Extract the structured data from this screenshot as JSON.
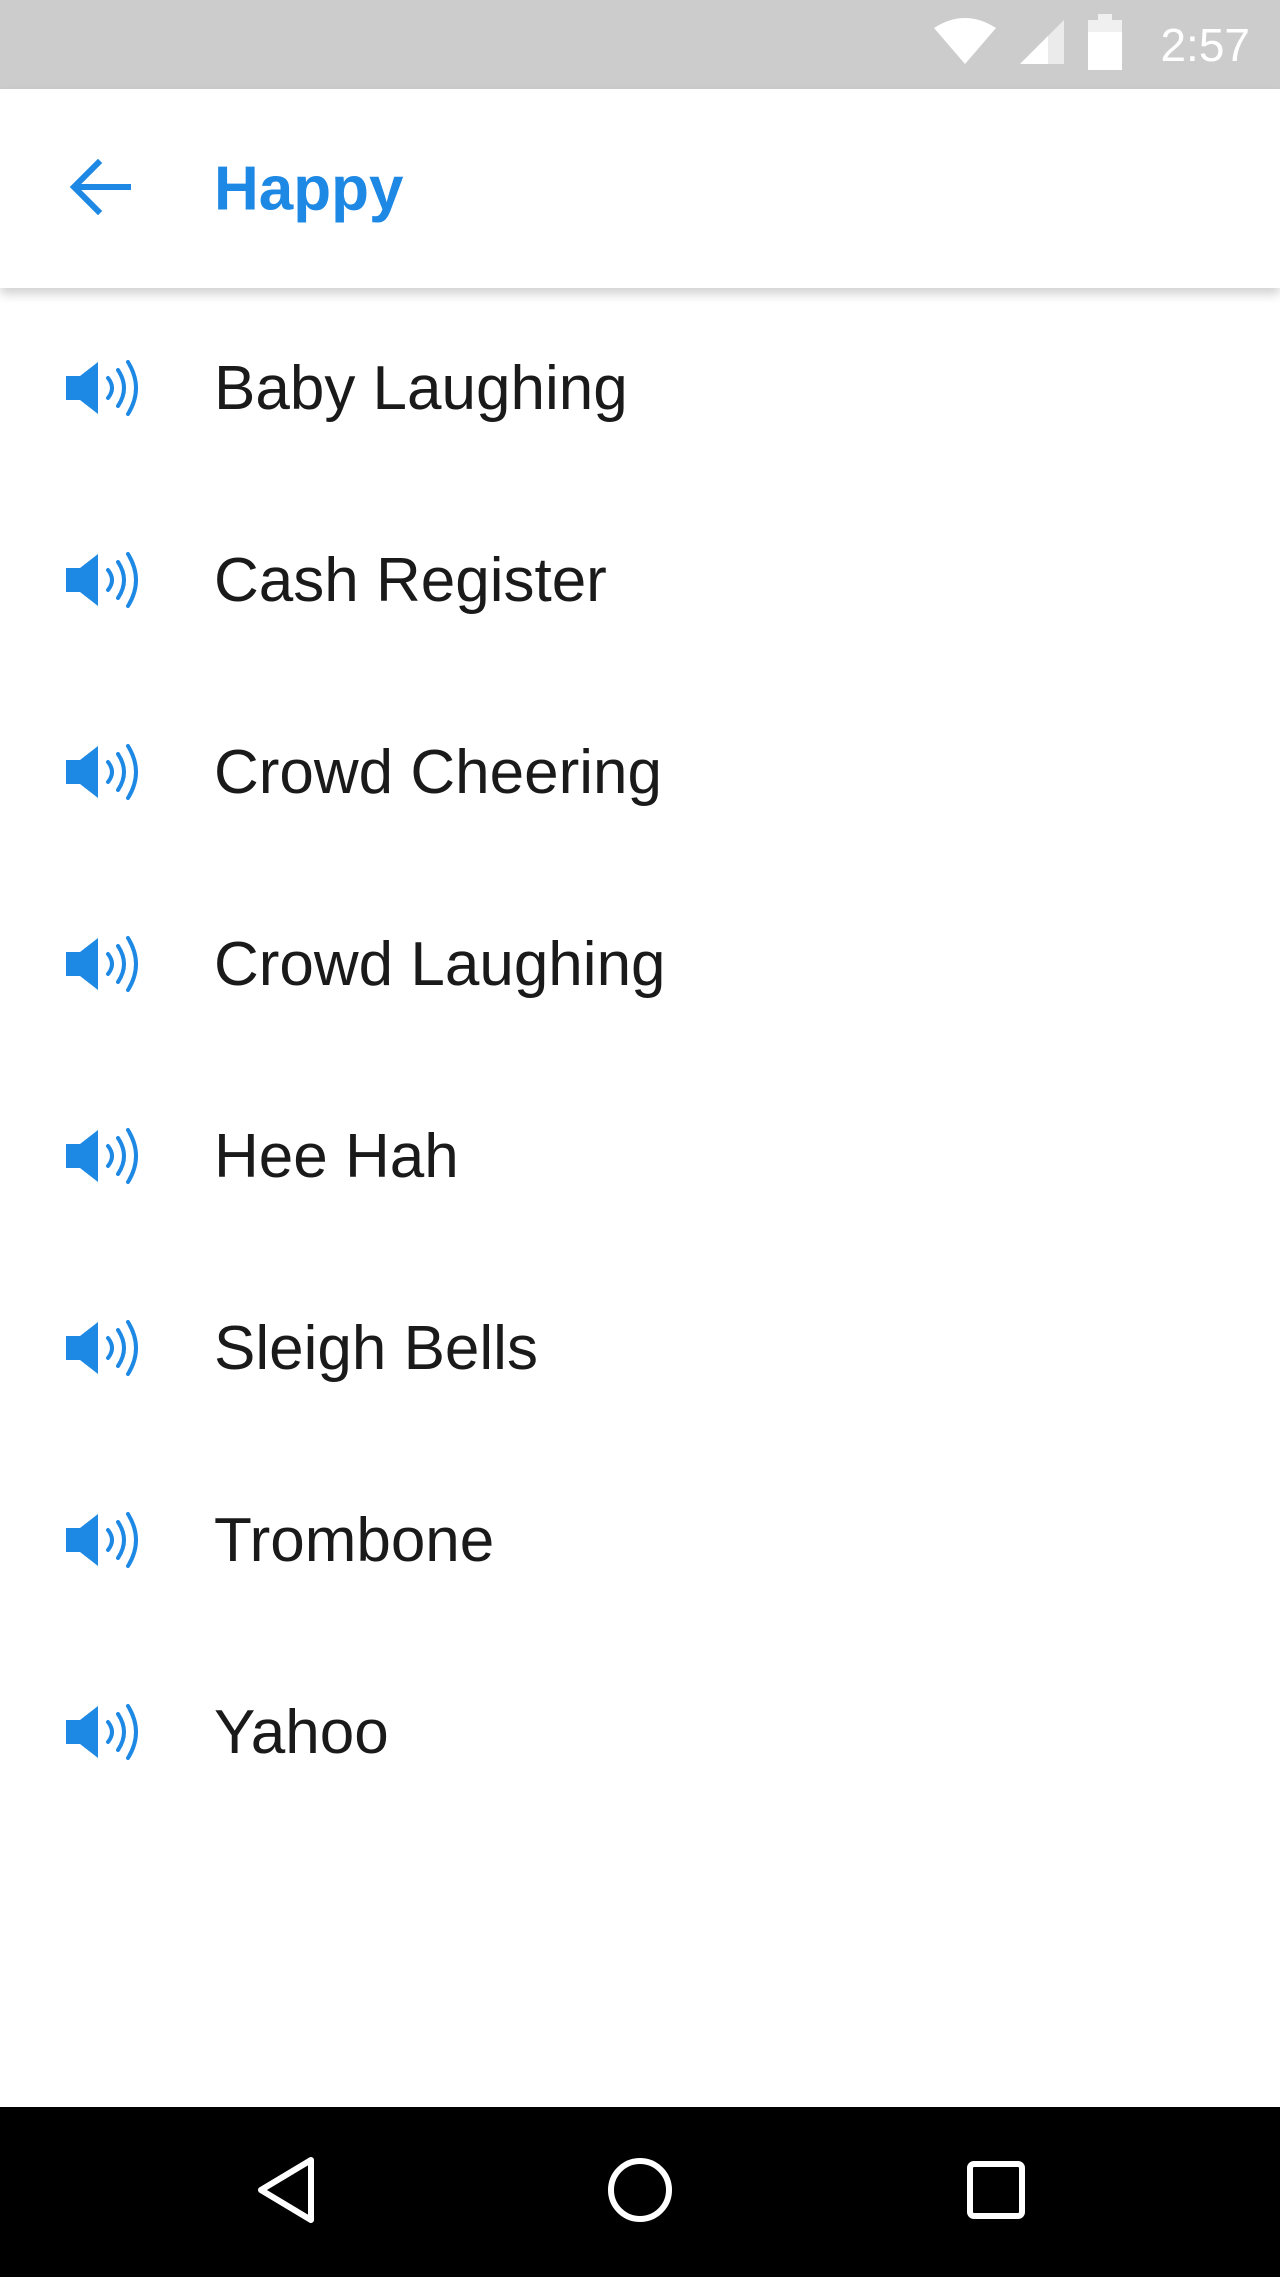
{
  "status_bar": {
    "time": "2:57",
    "icons": [
      "wifi-icon",
      "signal-icon",
      "battery-icon"
    ]
  },
  "app_bar": {
    "title": "Happy",
    "back_icon": "arrow-left-icon"
  },
  "sounds": [
    {
      "label": "Baby Laughing",
      "icon": "speaker-icon"
    },
    {
      "label": "Cash Register",
      "icon": "speaker-icon"
    },
    {
      "label": "Crowd Cheering",
      "icon": "speaker-icon"
    },
    {
      "label": "Crowd Laughing",
      "icon": "speaker-icon"
    },
    {
      "label": "Hee Hah",
      "icon": "speaker-icon"
    },
    {
      "label": "Sleigh Bells",
      "icon": "speaker-icon"
    },
    {
      "label": "Trombone",
      "icon": "speaker-icon"
    },
    {
      "label": "Yahoo",
      "icon": "speaker-icon"
    }
  ],
  "nav_bar": {
    "buttons": [
      "back-triangle-icon",
      "home-circle-icon",
      "recents-square-icon"
    ]
  },
  "colors": {
    "accent": "#1e88e5",
    "status_bar": "#cccccc",
    "text": "#1a1a1a",
    "nav_bar": "#000000"
  }
}
